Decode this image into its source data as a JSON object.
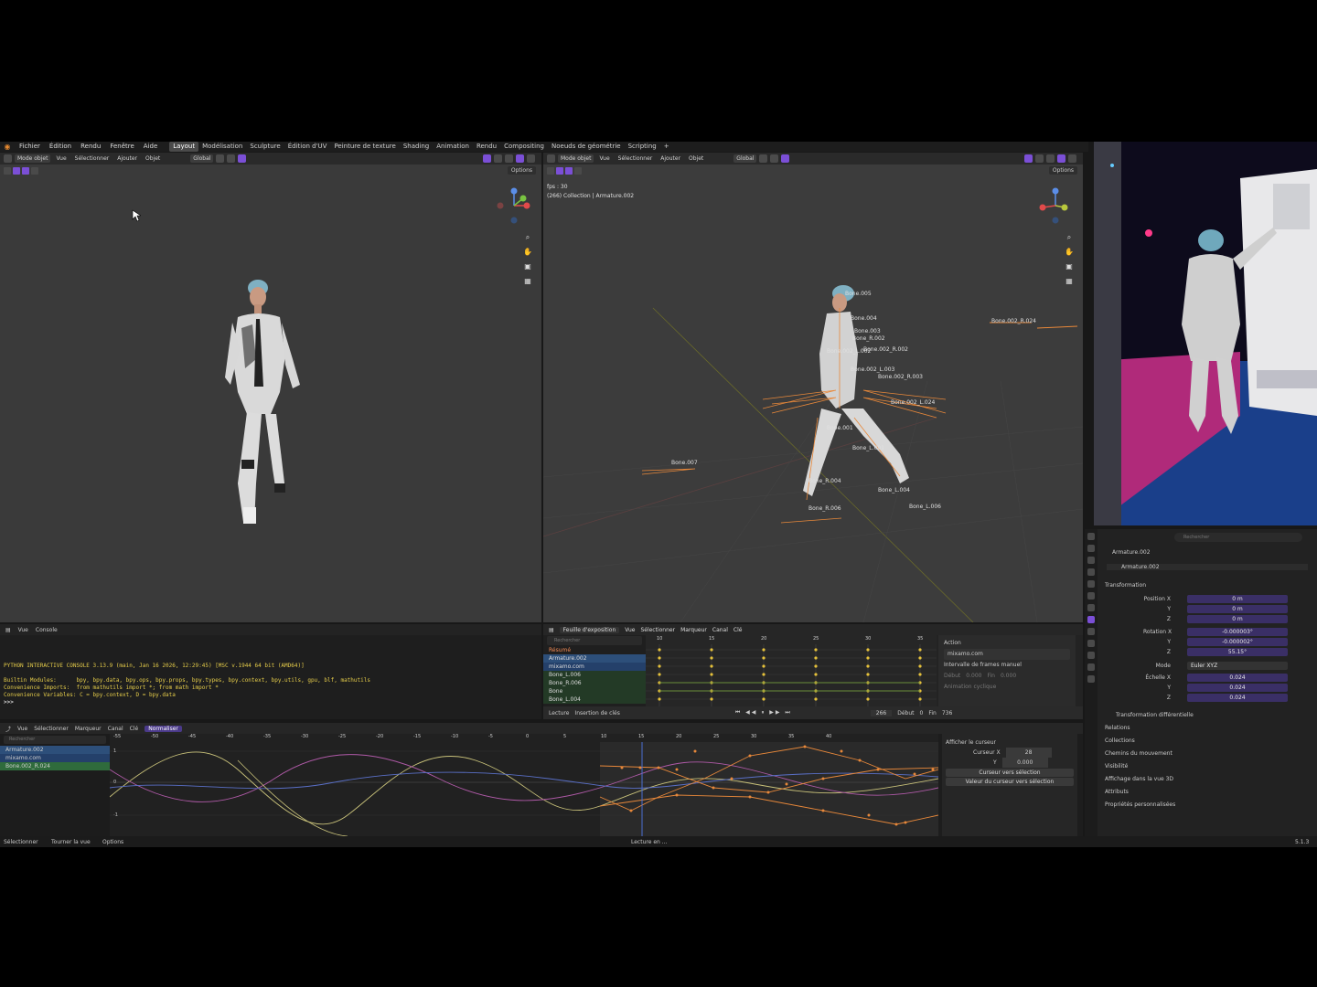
{
  "menu": [
    "Fichier",
    "Édition",
    "Rendu",
    "Fenêtre",
    "Aide"
  ],
  "workspaces": [
    {
      "label": "Layout",
      "active": true
    },
    {
      "label": "Modélisation",
      "active": false
    },
    {
      "label": "Sculpture",
      "active": false
    },
    {
      "label": "Édition d'UV",
      "active": false
    },
    {
      "label": "Peinture de texture",
      "active": false
    },
    {
      "label": "Shading",
      "active": false
    },
    {
      "label": "Animation",
      "active": false
    },
    {
      "label": "Rendu",
      "active": false
    },
    {
      "label": "Compositing",
      "active": false
    },
    {
      "label": "Noeuds de géométrie",
      "active": false
    },
    {
      "label": "Scripting",
      "active": false
    },
    {
      "label": "+",
      "active": false
    }
  ],
  "viewport_left": {
    "mode": "Mode objet",
    "menu": [
      "Vue",
      "Sélectionner",
      "Ajouter",
      "Objet"
    ],
    "transform": "Global",
    "options": "Options"
  },
  "viewport_right": {
    "mode": "Mode objet",
    "menu": [
      "Vue",
      "Sélectionner",
      "Ajouter",
      "Objet"
    ],
    "transform": "Global",
    "options": "Options",
    "fps": "fps : 30",
    "info": "(266) Collection | Armature.002",
    "bone_labels": [
      "Bone.005",
      "Bone.004",
      "Bone.003",
      "Bone_R.002",
      "Bone.002_L.002",
      "Bone.002_R.002",
      "Bone.002_L.003",
      "Bone.002_R.003",
      "Bone.001",
      "Bone_L.001",
      "Bone_R.004",
      "Bone_L.004",
      "Bone_R.006",
      "Bone_L.006",
      "Bone.002_R.024",
      "Bone.002_L.024",
      "Bone.007"
    ]
  },
  "console": {
    "menu": [
      "Vue",
      "Console"
    ],
    "lines": [
      "PYTHON INTERACTIVE CONSOLE 3.13.9 (main, Jan 16 2026, 12:29:45) [MSC v.1944 64 bit (AMD64)]",
      "",
      "Builtin Modules:      bpy, bpy.data, bpy.ops, bpy.props, bpy.types, bpy.context, bpy.utils, gpu, blf, mathutils",
      "Convenience Imports:  from mathutils import *; from math import *",
      "Convenience Variables: C = bpy.context, D = bpy.data",
      ">>> "
    ]
  },
  "dope": {
    "mode": "Feuille d'exposition",
    "menu": [
      "Vue",
      "Sélectionner",
      "Marqueur",
      "Canal",
      "Clé"
    ],
    "search_placeholder": "Rechercher",
    "channels": [
      {
        "label": "Résumé",
        "kind": "sum"
      },
      {
        "label": "Armature.002",
        "kind": "arm"
      },
      {
        "label": "mixamo.com",
        "kind": "obj"
      },
      {
        "label": "Bone_L.006",
        "kind": "bone"
      },
      {
        "label": "Bone_R.006",
        "kind": "bone"
      },
      {
        "label": "Bone",
        "kind": "bone"
      },
      {
        "label": "Bone_L.004",
        "kind": "bone"
      }
    ],
    "ruler": [
      "10",
      "15",
      "20",
      "25",
      "30",
      "35"
    ],
    "side": {
      "action": "Action",
      "action_name": "mixamo.com",
      "manual_range": "Intervalle de frames manuel",
      "start_label": "Début",
      "start": "0.000",
      "end_label": "Fin",
      "end": "0.000",
      "cyclic": "Animation cyclique"
    },
    "playback": {
      "lecture": "Lecture",
      "keying": "Insertion de clés",
      "current": "266",
      "start_label": "Début",
      "start": "0",
      "end_label": "Fin",
      "end": "736"
    }
  },
  "graph": {
    "menu": [
      "Vue",
      "Sélectionner",
      "Marqueur",
      "Canal",
      "Clé"
    ],
    "normalize": "Normaliser",
    "search_placeholder": "Rechercher",
    "channels": [
      "Armature.002",
      "mixamo.com",
      "Bone.002_R.024"
    ],
    "ruler": [
      "-55",
      "-50",
      "-45",
      "-40",
      "-35",
      "-30",
      "-25",
      "-20",
      "-15",
      "-10",
      "-5",
      "0",
      "5",
      "10",
      "15",
      "20",
      "25",
      "30",
      "35",
      "40"
    ],
    "yticks": [
      "1",
      "0",
      "-1"
    ],
    "side": {
      "show_cursor": "Afficher le curseur",
      "cursor_x_label": "Curseur X",
      "cursor_x": "28",
      "cursor_y_label": "Y",
      "cursor_y": "0.000",
      "btn1": "Curseur vers sélection",
      "btn2": "Valeur du curseur vers sélection"
    }
  },
  "status": {
    "select": "Sélectionner",
    "rotate": "Tourner la vue",
    "options": "Options",
    "center": "Lecture en ...",
    "version": "5.1.3"
  },
  "properties": {
    "search_placeholder": "Rechercher",
    "object": "Armature.002",
    "object_data": "Armature.002",
    "transform": "Transformation",
    "loc_label": [
      "Position X",
      "Y",
      "Z"
    ],
    "loc": [
      "0 m",
      "0 m",
      "0 m"
    ],
    "rot_label": [
      "Rotation X",
      "Y",
      "Z"
    ],
    "rot": [
      "-0.000003°",
      "-0.000002°",
      "55.15°"
    ],
    "mode_label": "Mode",
    "mode": "Euler XYZ",
    "scale_label": [
      "Échelle X",
      "Y",
      "Z"
    ],
    "scale": [
      "0.024",
      "0.024",
      "0.024"
    ],
    "sections": [
      "Transformation différentielle",
      "Relations",
      "Collections",
      "Chemins du mouvement",
      "Visibilité",
      "Affichage dans la vue 3D",
      "Attributs",
      "Propriétés personnalisées"
    ]
  },
  "colors": {
    "accent": "#7b4fd6",
    "keyframe": "#e6c23a",
    "bone": "#e8883a",
    "panel": "#222222"
  }
}
